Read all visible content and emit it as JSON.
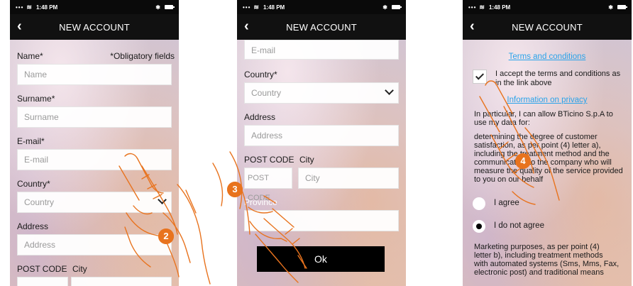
{
  "status_bar": {
    "signal": "•••",
    "time": "1:48 PM",
    "bluetooth": "✱"
  },
  "nav": {
    "back_icon": "chevron-left-icon",
    "title": "NEW ACCOUNT"
  },
  "screen1": {
    "name_label": "Name*",
    "obligatory_note": "*Obligatory fields",
    "name_placeholder": "Name",
    "surname_label": "Surname*",
    "surname_placeholder": "Surname",
    "email_label": "E-mail*",
    "email_placeholder": "E-mail",
    "country_label": "Country*",
    "country_placeholder": "Country",
    "address_label": "Address",
    "address_placeholder": "Address",
    "postcode_label": "POST CODE",
    "city_label": "City",
    "step_marker": "2"
  },
  "screen2": {
    "email_placeholder": "E-mail",
    "country_label": "Country*",
    "country_placeholder": "Country",
    "address_label": "Address",
    "address_placeholder": "Address",
    "postcode_label": "POST CODE",
    "city_label": "City",
    "postcode_placeholder": "POST CODE",
    "city_placeholder": "City",
    "province_label": "Province",
    "ok_label": "Ok",
    "step_marker": "3"
  },
  "screen3": {
    "terms_link": "Terms and conditions",
    "accept_text_1": "I accept the terms and conditions as",
    "accept_text_2": "in the link above",
    "privacy_link": "Information on privacy",
    "privacy_intro_1": "In particular, I can allow BTicino S.p.A to",
    "privacy_intro_2": "use my data for:",
    "purpose_a": [
      "determining the degree of customer",
      "satisfaction, as per point (4) letter a),",
      "including the treatment method and the",
      "communication to the company who will",
      "measure the quality of the service provided",
      "to you on our behalf"
    ],
    "agree_label": "I agree",
    "disagree_label": "I do not agree",
    "purpose_b": [
      "Marketing purposes, as per point (4)",
      "letter b), including treatment methods",
      "with automated systems (Sms, Mms, Fax,",
      "electronic post) and traditional means"
    ],
    "step_marker": "4"
  },
  "colors": {
    "accent": "#e8731e",
    "link": "#29a3ea",
    "navbar": "#111111"
  }
}
